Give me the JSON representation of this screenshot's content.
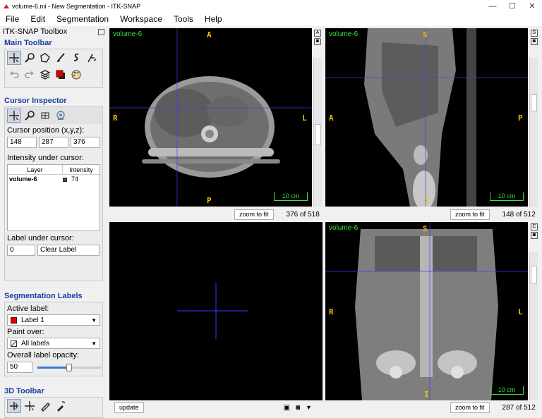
{
  "window": {
    "title": "volume-6.nii - New Segmentation - ITK-SNAP",
    "minimize": "—",
    "maximize": "☐",
    "close": "✕"
  },
  "menu": [
    "File",
    "Edit",
    "Segmentation",
    "Workspace",
    "Tools",
    "Help"
  ],
  "toolbox": {
    "title": "ITK-SNAP Toolbox",
    "main_toolbar": "Main Toolbar",
    "cursor_inspector": "Cursor Inspector",
    "cursor_position_label": "Cursor position (x,y,z):",
    "cursor_x": "148",
    "cursor_y": "287",
    "cursor_z": "376",
    "intensity_label": "Intensity under cursor:",
    "col_layer": "Layer",
    "col_intensity": "Intensity",
    "layer_name": "volume-6",
    "layer_value": "74",
    "label_under_cursor": "Label under cursor:",
    "label_id": "0",
    "label_name": "Clear Label",
    "seg_labels": "Segmentation Labels",
    "active_label_title": "Active label:",
    "active_label": "Label 1",
    "active_label_color": "#e00000",
    "paint_over_title": "Paint over:",
    "paint_over": "All labels",
    "opacity_title": "Overall label opacity:",
    "opacity_value": "50",
    "toolbar_3d": "3D Toolbar"
  },
  "views": {
    "axial": {
      "name": "volume-6",
      "top": "A",
      "bottom": "P",
      "left": "R",
      "right": "L",
      "scale": "10 cm",
      "zoom": "zoom to fit",
      "slice": "376 of 518"
    },
    "sagittal": {
      "name": "volume-6",
      "top": "S",
      "bottom": "I",
      "left": "A",
      "right": "P",
      "scale": "10 cm",
      "zoom": "zoom to fit",
      "slice": "148 of 512"
    },
    "coronal": {
      "name": "volume-6",
      "top": "S",
      "bottom": "I",
      "left": "R",
      "right": "L",
      "scale": "10 cm",
      "zoom": "zoom to fit",
      "slice": "287 of 512"
    },
    "render3d": {
      "update": "update"
    }
  },
  "colors": {
    "label_color": "#e00000",
    "cursor": "#3a3aff",
    "overlay_text": "#f0c000",
    "name_text": "#3ee03e"
  }
}
